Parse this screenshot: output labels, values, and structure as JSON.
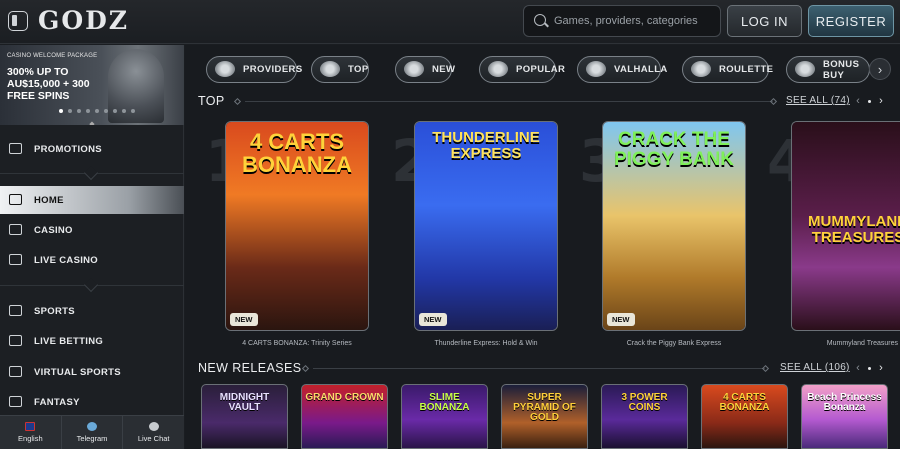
{
  "header": {
    "logo": "GODZ",
    "search_placeholder": "Games, providers, categories",
    "login_label": "LOG IN",
    "register_label": "REGISTER"
  },
  "promo": {
    "small": "CASINO WELCOME PACKAGE",
    "headline": "300% UP TO AU$15,000 + 300 FREE SPINS",
    "slides": 9,
    "active_slide": 1
  },
  "sidebar": {
    "items": [
      {
        "label": "PROMOTIONS",
        "icon": "gift-icon"
      },
      {
        "label": "HOME",
        "icon": "home-icon"
      },
      {
        "label": "CASINO",
        "icon": "slot-machine-icon"
      },
      {
        "label": "LIVE CASINO",
        "icon": "cards-icon"
      },
      {
        "label": "SPORTS",
        "icon": "soccer-ball-icon"
      },
      {
        "label": "LIVE BETTING",
        "icon": "live-icon"
      },
      {
        "label": "VIRTUAL SPORTS",
        "icon": "virtual-icon"
      },
      {
        "label": "FANTASY",
        "icon": "shield-icon"
      }
    ],
    "active": "HOME",
    "footer": [
      {
        "label": "English",
        "icon": "flag-icon"
      },
      {
        "label": "Telegram",
        "icon": "telegram-icon"
      },
      {
        "label": "Live Chat",
        "icon": "chat-icon"
      }
    ]
  },
  "categories": [
    {
      "label": "PROVIDERS",
      "icon": "book-icon"
    },
    {
      "label": "TOP",
      "icon": "viking-helmet-icon"
    },
    {
      "label": "NEW",
      "icon": "bell-icon"
    },
    {
      "label": "POPULAR",
      "icon": "star-icon"
    },
    {
      "label": "VALHALLA",
      "icon": "castle-icon"
    },
    {
      "label": "ROULETTE",
      "icon": "roulette-icon"
    },
    {
      "label": "BONUS BUY",
      "icon": "bonus-icon"
    }
  ],
  "top": {
    "title": "TOP",
    "see_all": "SEE ALL (74)",
    "games": [
      {
        "rank": "1",
        "title": "4 CARTS BONANZA",
        "caption": "4 CARTS BONANZA: Trinity Series",
        "badge": "NEW"
      },
      {
        "rank": "2",
        "title": "THUNDERLINE EXPRESS",
        "caption": "Thunderline Express: Hold & Win",
        "badge": "NEW"
      },
      {
        "rank": "3",
        "title": "CRACK THE PIGGY BANK",
        "caption": "Crack the Piggy Bank Express",
        "badge": "NEW"
      },
      {
        "rank": "4",
        "title": "MUMMYLAND TREASURES",
        "caption": "Mummyland Treasures",
        "badge": ""
      }
    ]
  },
  "new_releases": {
    "title": "NEW RELEASES",
    "see_all": "SEE ALL (106)",
    "games": [
      {
        "title": "MIDNIGHT VAULT"
      },
      {
        "title": "GRAND CROWN"
      },
      {
        "title": "SLIME BONANZA"
      },
      {
        "title": "SUPER PYRAMID OF GOLD"
      },
      {
        "title": "3 POWER COINS"
      },
      {
        "title": "4 CARTS BONANZA"
      },
      {
        "title": "Beach Princess Bonanza"
      }
    ]
  },
  "colors": {
    "accent": "#3c6070",
    "background": "#181b1f"
  }
}
